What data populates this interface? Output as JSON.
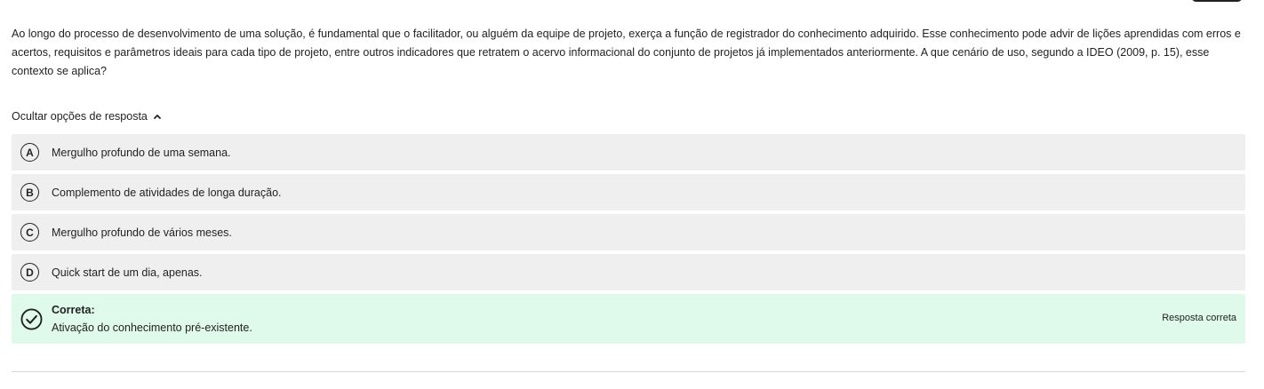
{
  "question": {
    "text": "Ao longo do processo de desenvolvimento de uma solução, é fundamental que o facilitador, ou alguém da equipe de projeto, exerça a função de registrador do conhecimento adquirido. Esse conhecimento pode advir de lições aprendidas com erros e acertos, requisitos e parâmetros ideais para cada tipo de projeto, entre outros indicadores que retratem o acervo informacional do conjunto de projetos já implementados anteriormente. A que cenário de uso, segundo a IDEO (2009, p. 15), esse contexto se aplica?"
  },
  "toggle": {
    "label": "Ocultar opções de resposta",
    "icon": "chevron-up-icon"
  },
  "options": [
    {
      "letter": "A",
      "text": "Mergulho profundo de uma semana."
    },
    {
      "letter": "B",
      "text": "Complemento de atividades de longa duração."
    },
    {
      "letter": "C",
      "text": "Mergulho profundo de vários meses."
    },
    {
      "letter": "D",
      "text": "Quick start de um dia, apenas."
    }
  ],
  "correct": {
    "label": "Correta:",
    "text": "Ativação do conhecimento pré-existente.",
    "tag": "Resposta correta",
    "icon": "check-circle-icon",
    "background": "#dffaea"
  },
  "colors": {
    "option_background": "#efefef",
    "text": "#222222"
  }
}
